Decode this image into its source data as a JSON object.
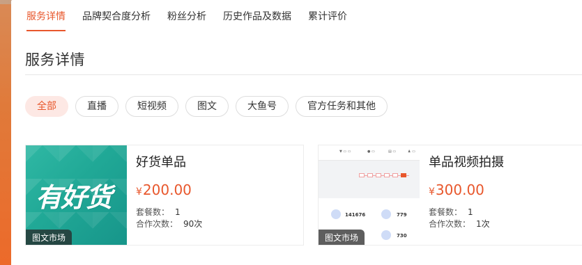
{
  "tabs": [
    {
      "label": "服务详情",
      "active": true
    },
    {
      "label": "品牌契合度分析"
    },
    {
      "label": "粉丝分析"
    },
    {
      "label": "历史作品及数据"
    },
    {
      "label": "累计评价"
    }
  ],
  "section_title": "服务详情",
  "filters": [
    {
      "label": "全部",
      "active": true
    },
    {
      "label": "直播"
    },
    {
      "label": "短视频"
    },
    {
      "label": "图文"
    },
    {
      "label": "大鱼号"
    },
    {
      "label": "官方任务和其他"
    }
  ],
  "cards": [
    {
      "thumb_text": "有好货",
      "badge": "图文市场",
      "title": "好货单品",
      "currency": "¥",
      "price": "200.00",
      "package_label": "套餐数：",
      "package_value": "1",
      "coop_label": "合作次数：",
      "coop_value": "90次"
    },
    {
      "badge": "图文市场",
      "title": "单品视频拍摄",
      "currency": "¥",
      "price": "300.00",
      "package_label": "套餐数：",
      "package_value": "1",
      "coop_label": "合作次数：",
      "coop_value": "1次",
      "thumb_stats": [
        "141676",
        "779",
        "730"
      ]
    }
  ],
  "colors": {
    "accent": "#e8572c",
    "chip_active_bg": "#fde8e4",
    "thumb_teal": "#20a896"
  }
}
